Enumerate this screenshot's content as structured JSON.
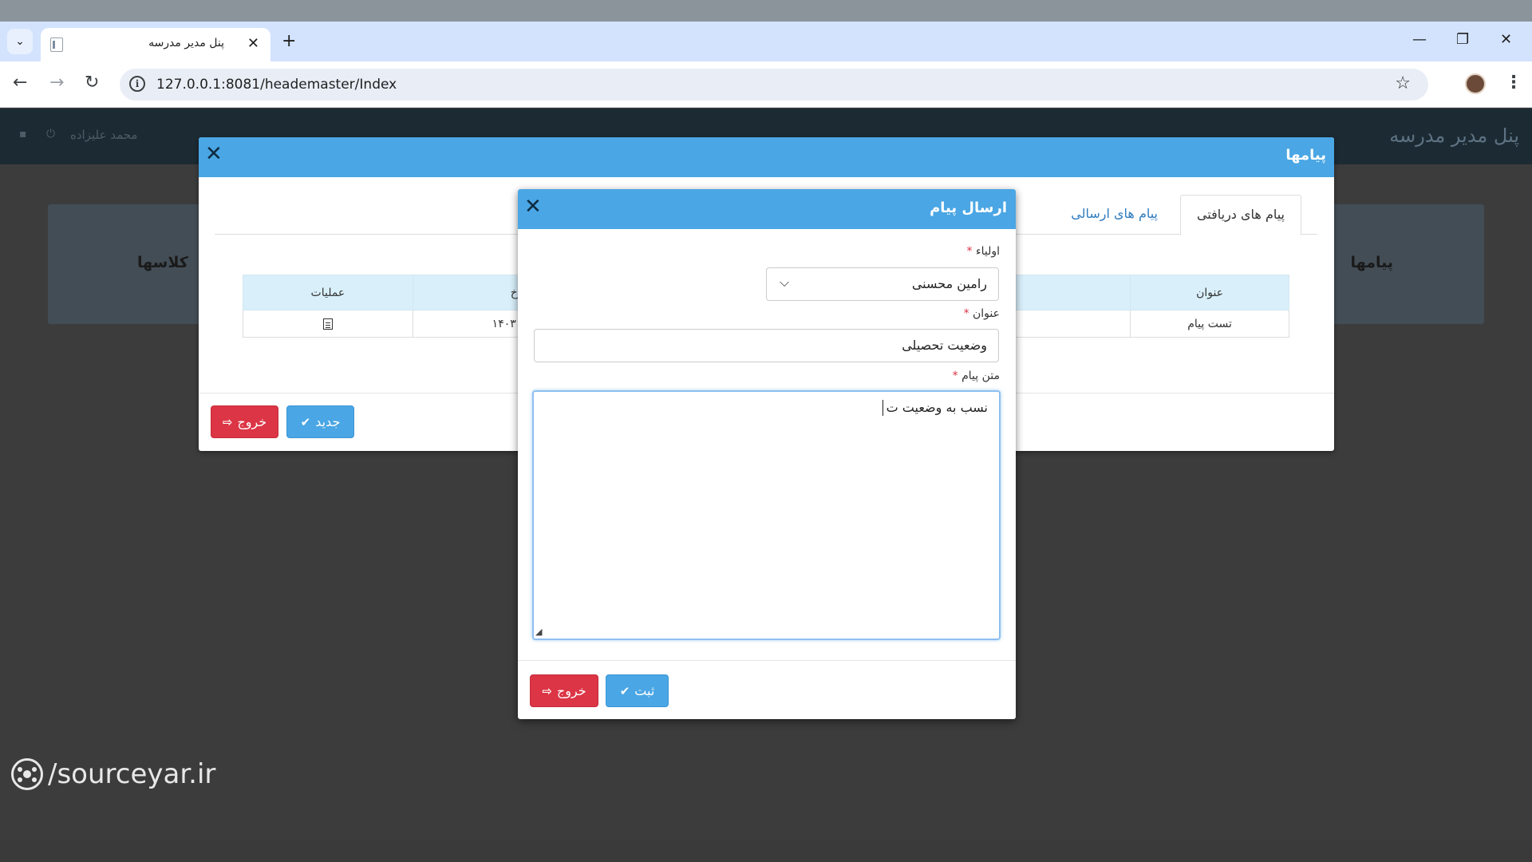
{
  "browser": {
    "tab_title": "پنل مدیر مدرسه",
    "url": "127.0.0.1:8081/heademaster/Index"
  },
  "app": {
    "title": "پنل مدیر مدرسه",
    "user_name": "محمد علیزاده",
    "cards": {
      "right_label": "پیامها",
      "left_label": "کلاسها"
    }
  },
  "messages_modal": {
    "title": "پیامها",
    "tabs": [
      {
        "label": "پیام های دریافتی",
        "active": true
      },
      {
        "label": "پیام های ارسالی",
        "active": false
      }
    ],
    "table": {
      "headers": {
        "operations": "عملیات",
        "date_partial": "خ",
        "subject": "عنوان"
      },
      "rows": [
        {
          "operations_icon": "document-icon",
          "date_partial": "۱۴۰۳",
          "subject": "تست پیام"
        }
      ]
    },
    "buttons": {
      "new": "جدید",
      "exit": "خروج"
    }
  },
  "send_modal": {
    "title": "ارسال پیام",
    "parent_label": "اولیاء",
    "parent_value": "رامین محسنی",
    "subject_label": "عنوان",
    "subject_value": "وضعیت تحصیلی",
    "body_label": "متن پیام",
    "body_value": "نسب به وضعیت ت",
    "required_mark": "*",
    "buttons": {
      "submit": "ثبت",
      "exit": "خروج"
    }
  },
  "watermark": "/sourceyar.ir",
  "colors": {
    "primary": "#4aa6e4",
    "danger": "#dc3545",
    "table_header": "#d9f0fb"
  }
}
